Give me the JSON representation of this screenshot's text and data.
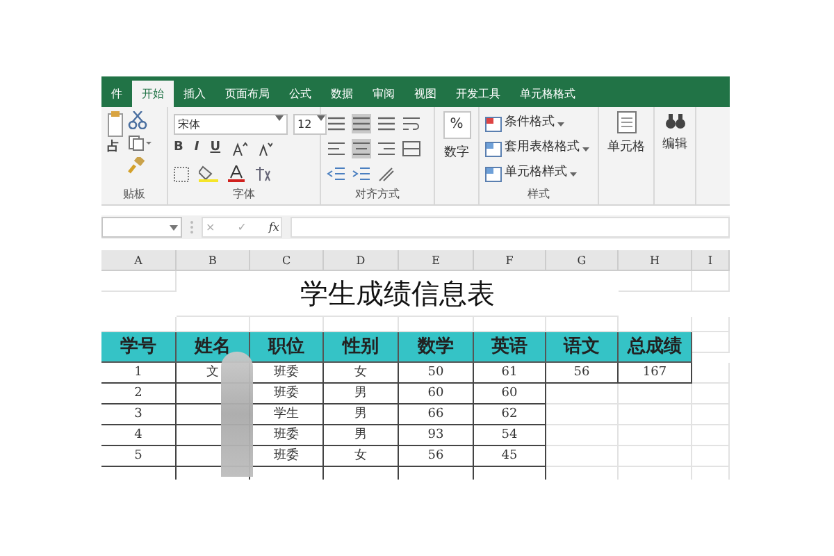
{
  "ribbon_tabs": [
    {
      "label": "件",
      "selected": false
    },
    {
      "label": "开始",
      "selected": true
    },
    {
      "label": "插入",
      "selected": false
    },
    {
      "label": "页面布局",
      "selected": false
    },
    {
      "label": "公式",
      "selected": false
    },
    {
      "label": "数据",
      "selected": false
    },
    {
      "label": "审阅",
      "selected": false
    },
    {
      "label": "视图",
      "selected": false
    },
    {
      "label": "开发工具",
      "selected": false
    },
    {
      "label": "单元格格式",
      "selected": false
    }
  ],
  "ribbon": {
    "clipboard": {
      "paste_label": "占",
      "group_label": "贴板"
    },
    "font": {
      "font_name": "宋体",
      "font_size": "12",
      "bold": "B",
      "italic": "I",
      "underline": "U",
      "group_label": "字体"
    },
    "alignment": {
      "group_label": "对齐方式"
    },
    "number": {
      "symbol": "%",
      "label": "数字"
    },
    "styles": {
      "items": [
        "条件格式",
        "套用表格格式",
        "单元格样式"
      ],
      "group_label": "样式"
    },
    "cells": {
      "label": "单元格"
    },
    "editing": {
      "label": "编辑"
    }
  },
  "formula_bar": {
    "cancel": "×",
    "enter": "✓",
    "function": "fx"
  },
  "sheet": {
    "columns": [
      "A",
      "B",
      "C",
      "D",
      "E",
      "F",
      "G",
      "H",
      "I"
    ],
    "title": "学生成绩信息表",
    "headers": [
      "学号",
      "姓名",
      "职位",
      "性别",
      "数学",
      "英语",
      "语文",
      "总成绩"
    ],
    "rows": [
      {
        "id": "1",
        "name": "文",
        "role": "班委",
        "gender": "女",
        "math": "50",
        "english": "61",
        "chinese": "56",
        "total": "167"
      },
      {
        "id": "2",
        "role": "班委",
        "gender": "男",
        "math": "60",
        "english": "60"
      },
      {
        "id": "3",
        "role": "学生",
        "gender": "男",
        "math": "66",
        "english": "62"
      },
      {
        "id": "4",
        "role": "班委",
        "gender": "男",
        "math": "93",
        "english": "54"
      },
      {
        "id": "5",
        "role": "班委",
        "gender": "女",
        "math": "56",
        "english": "45"
      }
    ],
    "names_blurred": true
  }
}
